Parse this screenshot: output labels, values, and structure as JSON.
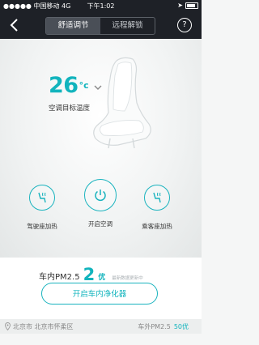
{
  "status_bar": {
    "carrier": "●●●●● 中国移动 4G",
    "time": "下午1:02",
    "battery_icon": "battery-icon"
  },
  "nav": {
    "back_icon": "chevron-left-icon",
    "tabs": [
      {
        "label": "舒适调节",
        "active": true
      },
      {
        "label": "远程解锁",
        "active": false
      }
    ],
    "help_label": "?"
  },
  "climate": {
    "temperature": "26",
    "unit": "°c",
    "label": "空调目标温度",
    "controls": [
      {
        "id": "driver",
        "label": "驾驶座加热",
        "icon": "seat-heat-icon"
      },
      {
        "id": "ac",
        "label": "开启空调",
        "icon": "power-icon"
      },
      {
        "id": "passenger",
        "label": "乘客座加热",
        "icon": "seat-heat-icon"
      }
    ]
  },
  "pm": {
    "label": "车内PM2.5",
    "value": "2",
    "grade": "优",
    "source": "最新数据更新中",
    "button_label": "开启车内净化器"
  },
  "footer": {
    "location": "北京市 北京市怀柔区",
    "outside_label": "车外PM2.5",
    "outside_value": "50优"
  },
  "colors": {
    "accent": "#12b4bd",
    "nav_bg": "#1e2127"
  }
}
